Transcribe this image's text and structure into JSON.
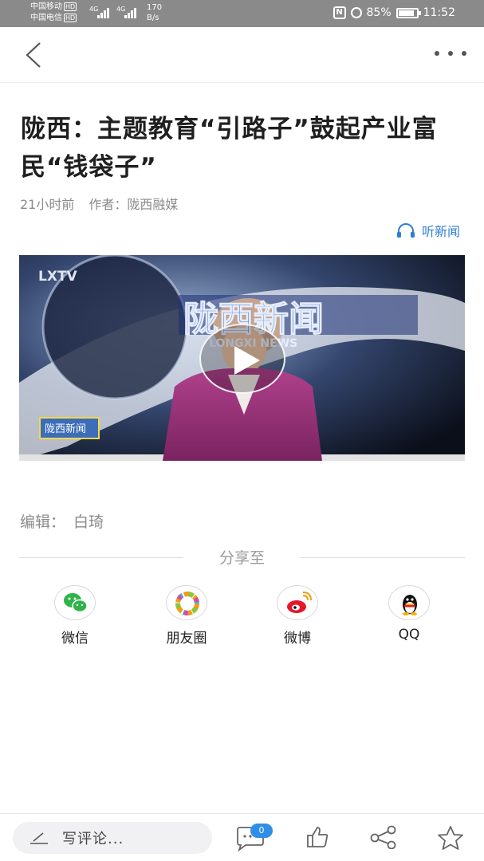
{
  "status_bar": {
    "carrier1": "中国移动",
    "carrier2": "中国电信",
    "hd": "HD",
    "net1": "4G",
    "net2": "4G",
    "speed_value": "170",
    "speed_unit": "B/s",
    "battery": "85%",
    "time": "11:52"
  },
  "navbar": {
    "back_icon": "chevron-left-icon",
    "more_icon": "more-horizontal-icon"
  },
  "article": {
    "title": "陇西：主题教育“引路子”鼓起产业富民“钱袋子”",
    "time_ago": "21小时前",
    "author_label": "作者：陇西融媒",
    "listen_label": "听新闻",
    "listen_color": "#2f7fd6",
    "video_logo": "LXTV",
    "video_banner": "陇西新闻",
    "video_banner_en": "LONGXI NEWS",
    "video_corner": "陇西新闻",
    "editor_label": "编辑：",
    "editor_name": "白琦"
  },
  "share": {
    "heading": "分享至",
    "items": [
      {
        "label": "微信",
        "icon": "wechat-icon",
        "color": "#2fb34a"
      },
      {
        "label": "朋友圈",
        "icon": "moments-icon",
        "color": "#f39c12"
      },
      {
        "label": "微博",
        "icon": "weibo-icon",
        "color": "#e6162d"
      },
      {
        "label": "QQ",
        "icon": "qq-icon",
        "color": "#111111"
      }
    ]
  },
  "bottom_bar": {
    "comment_placeholder": "写评论...",
    "comment_count": "0",
    "icons": [
      "pen-icon",
      "comment-icon",
      "like-icon",
      "share-icon",
      "star-icon"
    ],
    "accent": "#2f8fe6"
  }
}
